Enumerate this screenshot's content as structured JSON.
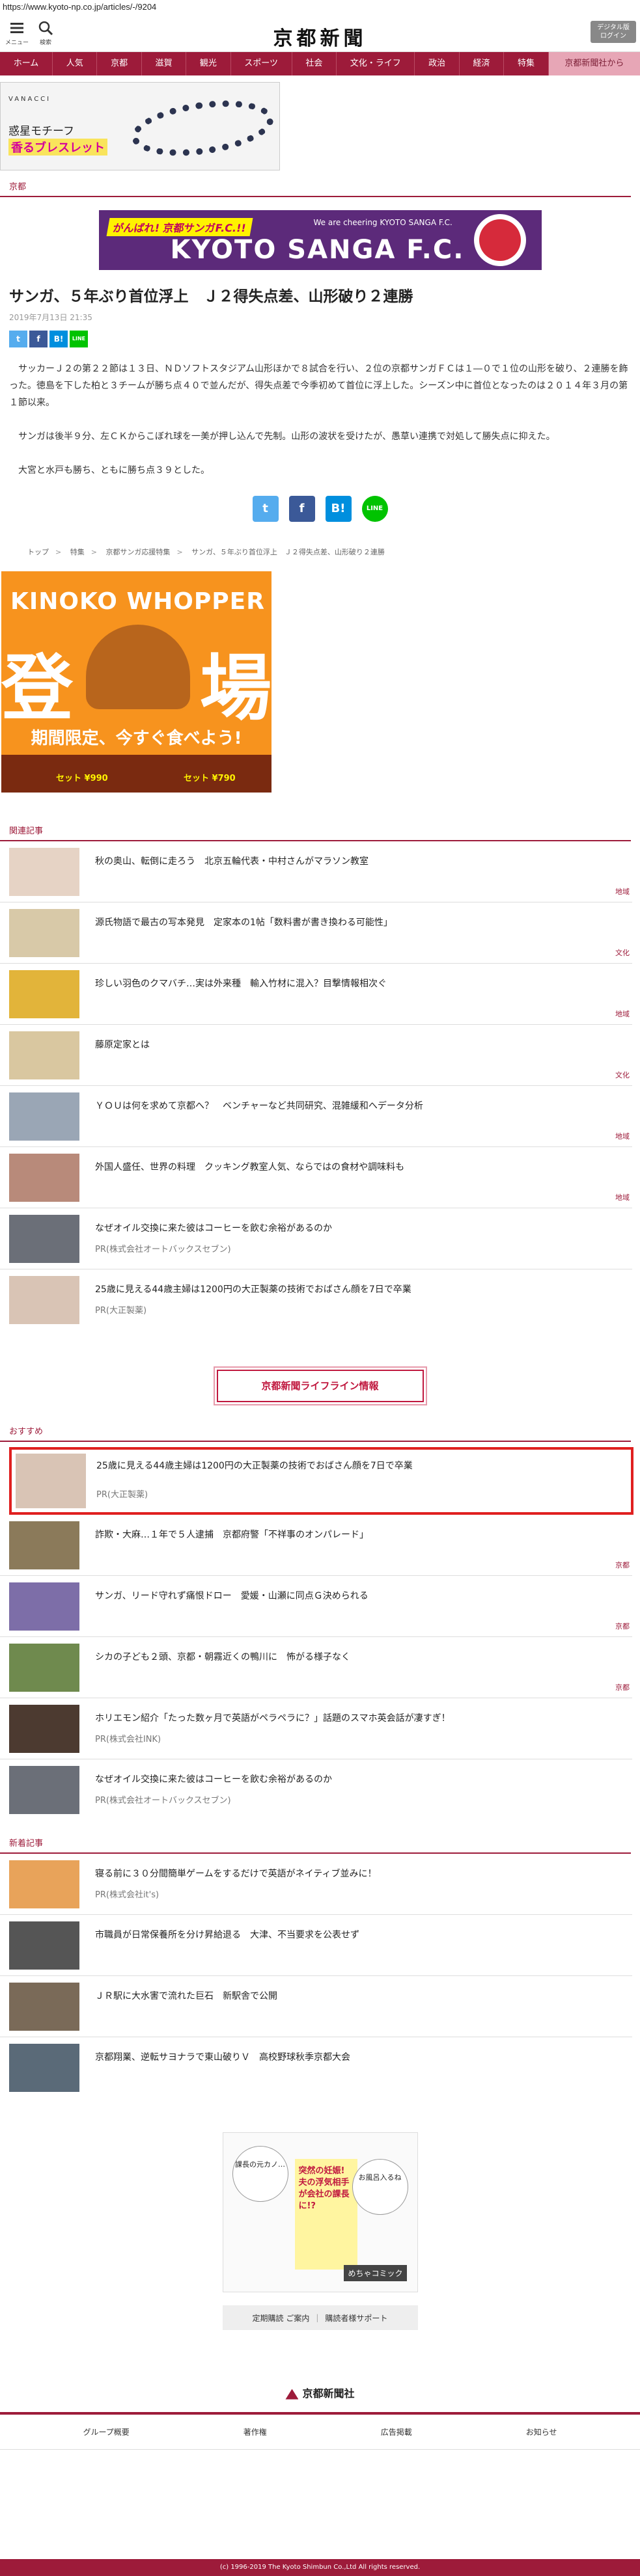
{
  "url": "https://www.kyoto-np.co.jp/articles/-/9204",
  "header": {
    "menu_label": "メニュー",
    "search_label": "検索",
    "logo": "京都新聞",
    "digital_label_1": "デジタル版",
    "digital_label_2": "ログイン"
  },
  "nav": [
    "ホーム",
    "人気",
    "京都",
    "滋賀",
    "観光",
    "スポーツ",
    "社会",
    "文化・ライフ",
    "政治",
    "経済",
    "特集",
    "京都新聞社から"
  ],
  "ad_top": {
    "brand": "VANACCI",
    "copy1": "惑星モチーフ",
    "copy2": "香るブレスレット"
  },
  "section": "京都",
  "sanga_ad": {
    "tag": "がんばれ! 京都サンガF.C.!!",
    "sub": "We are cheering KYOTO SANGA F.C.",
    "big": "KYOTO SANGA F.C."
  },
  "article": {
    "title": "サンガ、５年ぶり首位浮上　Ｊ２得失点差、山形破り２連勝",
    "date": "2019年7月13日 21:35",
    "paragraphs": [
      "サッカーＪ２の第２２節は１３日、ＮＤソフトスタジアム山形ほかで８試合を行い、２位の京都サンガＦＣは１―０で１位の山形を破り、２連勝を飾った。徳島を下した柏と３チームが勝ち点４０で並んだが、得失点差で今季初めて首位に浮上した。シーズン中に首位となったのは２０１４年３月の第１節以来。",
      "サンガは後半９分、左ＣＫからこぼれ球を一美が押し込んで先制。山形の波状を受けたが、愚草い連携で対処して勝失点に抑えた。",
      "大宮と水戸も勝ち、ともに勝ち点３９とした。"
    ]
  },
  "share": {
    "tw": "t",
    "fb": "f",
    "hb": "B!",
    "ln": "LINE"
  },
  "breadcrumb": [
    "トップ",
    "特集",
    "京都サンガ応援特集",
    "サンガ、５年ぶり首位浮上　Ｊ２得失点差、山形破り２連勝"
  ],
  "ad_burger": {
    "kinoko": "KINOKO WHOPPER",
    "kanji_left": "登",
    "kanji_right": "場",
    "catch": "期間限定、今すぐ食べよう!",
    "price_1": "セット ¥990",
    "price_2": "セット ¥790"
  },
  "related": {
    "heading": "関連記事",
    "items": [
      {
        "title": "秋の奥山、転倒に走ろう　北京五輪代表・中村さんがマラソン教室",
        "cat": "地域"
      },
      {
        "title": "源氏物語で最古の写本発見　定家本の1帖「数料書が書き換わる可能性」",
        "cat": "文化"
      },
      {
        "title": "珍しい羽色のクマバチ…実は外来種　輸入竹材に混入？目撃情報相次ぐ",
        "cat": "地域"
      },
      {
        "title": "藤原定家とは",
        "cat": "文化"
      },
      {
        "title": "ＹＯＵは何を求めて京都へ？　ベンチャーなど共同研究、混雑緩和へデータ分析",
        "cat": "地域"
      },
      {
        "title": "外国人盛任、世界の料理　クッキング教室人気、ならではの食材や調味料も",
        "cat": "地域"
      },
      {
        "title": "なぜオイル交換に来た彼はコーヒーを飲む余裕があるのか",
        "pr": "PR(株式会社オートバックスセブン)"
      },
      {
        "title": "25歳に見える44歳主婦は1200円の大正製薬の技術でおばさん顔を7日で卒業",
        "pr": "PR(大正製薬)"
      }
    ]
  },
  "lifeline": "京都新聞ライフライン情報",
  "recommend": {
    "heading": "おすすめ",
    "highlight": {
      "title": "25歳に見える44歳主婦は1200円の大正製薬の技術でおばさん顔を7日で卒業",
      "pr": "PR(大正製薬)"
    },
    "items": [
      {
        "title": "詐欺・大麻…１年で５人逮捕　京都府警「不祥事のオンパレード」",
        "cat": "京都"
      },
      {
        "title": "サンガ、リード守れず痛恨ドロー　愛媛・山瀬に同点Ｇ決められる",
        "cat": "京都"
      },
      {
        "title": "シカの子ども２頭、京都・朝霧近くの鴨川に　怖がる様子なく",
        "cat": "京都"
      },
      {
        "title": "ホリエモン紹介「たった数ヶ月で英語がペラペラに？」話題のスマホ英会話が凄すぎ！",
        "pr": "PR(株式会社INK)"
      },
      {
        "title": "なぜオイル交換に来た彼はコーヒーを飲む余裕があるのか",
        "pr": "PR(株式会社オートバックスセブン)"
      }
    ]
  },
  "latest": {
    "heading": "新着記事",
    "items": [
      {
        "title": "寝る前に３０分間簡単ゲームをするだけで英語がネイティブ並みに！",
        "pr": "PR(株式会社it's)"
      },
      {
        "title": "市職員が日常保養所を分け昇給退る　大津、不当要求を公表せず",
        "cat": ""
      },
      {
        "title": "ＪＲ駅に大水害で流れた巨石　新駅舎で公開",
        "cat": ""
      },
      {
        "title": "京都翔業、逆転サヨナラで東山破りＶ　高校野球秋季京都大会",
        "cat": ""
      }
    ]
  },
  "manga_ad": {
    "bubble1": "課長の元カノ…",
    "yellow": "突然の妊娠! 夫の浮気相手が会社の課長に!?",
    "bubble2": "お風呂入るね",
    "logo": "めちゃコミック"
  },
  "sub_links": [
    "定期購読 ご案内",
    "購読者様サポート"
  ],
  "footer": {
    "logo": "京都新聞社",
    "links": [
      "グループ概要",
      "著作権",
      "広告掲載",
      "お知らせ"
    ],
    "copyright": "(c) 1996-2019 The Kyoto Shimbun Co.,Ltd All rights reserved."
  }
}
